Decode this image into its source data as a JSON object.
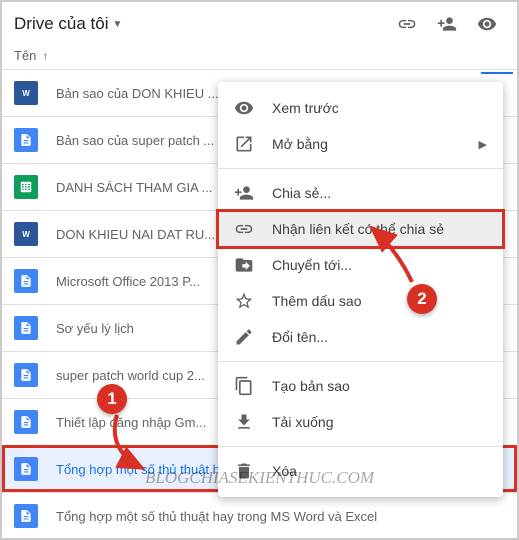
{
  "header": {
    "title": "Drive của tôi"
  },
  "column": {
    "name_label": "Tên"
  },
  "files": [
    {
      "name": "Bản sao của DON KHIEU ...",
      "icon": "word"
    },
    {
      "name": "Bản sao của super patch ...",
      "icon": "docs"
    },
    {
      "name": "DANH SÁCH THAM GIA ...",
      "icon": "sheets"
    },
    {
      "name": "DON KHIEU NAI DAT RU...",
      "icon": "word"
    },
    {
      "name": "Microsoft Office 2013 P...",
      "icon": "docs"
    },
    {
      "name": "Sơ yếu lý lịch",
      "icon": "docs"
    },
    {
      "name": "super patch world cup 2...",
      "icon": "docs"
    },
    {
      "name": "Thiết lập đăng nhập Gm...",
      "icon": "docs"
    },
    {
      "name": "Tổng hợp một số thủ thuật hay trong MS Word và ...",
      "icon": "docs",
      "selected": true,
      "highlighted": true
    },
    {
      "name": "Tổng hợp một số thủ thuật hay trong MS Word và Excel",
      "icon": "docs"
    }
  ],
  "context_menu": {
    "preview": "Xem trước",
    "open_with": "Mở bằng",
    "share": "Chia sẻ...",
    "get_link": "Nhận liên kết có thể chia sẻ",
    "move_to": "Chuyển tới...",
    "add_star": "Thêm dấu sao",
    "rename": "Đổi tên...",
    "make_copy": "Tạo bản sao",
    "download": "Tải xuống",
    "remove": "Xóa"
  },
  "annotations": {
    "step1": "1",
    "step2": "2"
  },
  "watermark": "BLOGCHIASEKIENTHUC.COM"
}
